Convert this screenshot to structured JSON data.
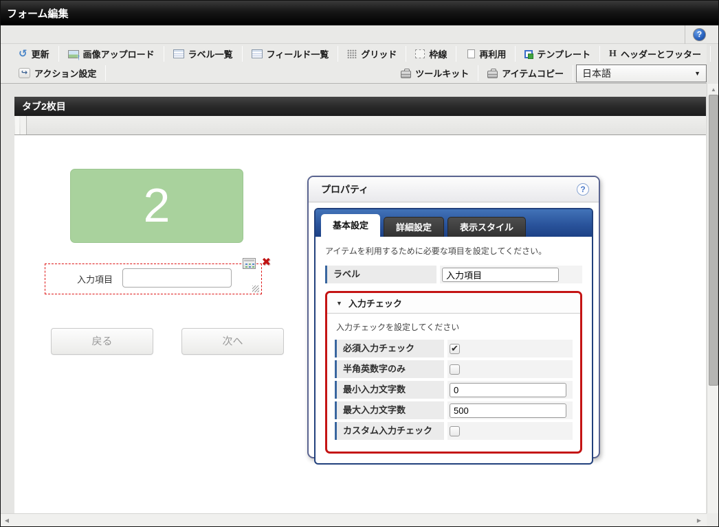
{
  "titlebar": {
    "title": "フォーム編集"
  },
  "header_strip": {
    "help_icon": "?"
  },
  "toolbar": {
    "row1": [
      {
        "label": "更新",
        "icon": "refresh-icon"
      },
      {
        "label": "画像アップロード",
        "icon": "image-upload-icon"
      },
      {
        "label": "ラベル一覧",
        "icon": "label-list-icon"
      },
      {
        "label": "フィールド一覧",
        "icon": "field-list-icon"
      },
      {
        "label": "グリッド",
        "icon": "grid-icon"
      },
      {
        "label": "枠線",
        "icon": "border-icon"
      },
      {
        "label": "再利用",
        "icon": "reuse-icon"
      },
      {
        "label": "テンプレート",
        "icon": "template-icon"
      },
      {
        "icon_text": "H",
        "label": "ヘッダーとフッター",
        "icon": "header-footer-icon"
      }
    ],
    "row2": [
      {
        "label": "アクション設定",
        "icon": "action-icon"
      },
      {
        "label": "ツールキット",
        "icon": "toolkit-icon"
      },
      {
        "label": "アイテムコピー",
        "icon": "item-copy-icon"
      }
    ],
    "language_select": {
      "value": "日本語",
      "arrow": "▼"
    }
  },
  "canvas": {
    "section_header": "タブ2枚目",
    "step_box": {
      "number": "2"
    },
    "selected_field": {
      "label": "入力項目",
      "value": "",
      "delete_glyph": "✖"
    },
    "buttons": {
      "back": "戻る",
      "next": "次へ"
    }
  },
  "properties": {
    "title": "プロパティ",
    "help_icon": "?",
    "tabs": [
      {
        "label": "基本設定"
      },
      {
        "label": "詳細設定"
      },
      {
        "label": "表示スタイル"
      }
    ],
    "instruction": "アイテムを利用するために必要な項目を設定してください。",
    "label_row": {
      "label": "ラベル",
      "value": "入力項目"
    },
    "validation_section": {
      "collapse_glyph": "▼",
      "title": "入力チェック",
      "instruction": "入力チェックを設定してください",
      "rows": [
        {
          "label": "必須入力チェック",
          "control": "checkbox",
          "check_glyph": "✔"
        },
        {
          "label": "半角英数字のみ",
          "control": "checkbox",
          "check_glyph": ""
        },
        {
          "label": "最小入力文字数",
          "control": "input",
          "value": "0"
        },
        {
          "label": "最大入力文字数",
          "control": "input",
          "value": "500"
        },
        {
          "label": "カスタム入力チェック",
          "control": "checkbox",
          "check_glyph": ""
        }
      ]
    }
  },
  "scrollbars": {
    "up": "▲",
    "down": "▼",
    "left": "◀",
    "right": "▶"
  },
  "colors": {
    "accent_blue": "#39669f",
    "tab_blue": "#2a549c",
    "highlight_red": "#c41414",
    "selection_red": "#dd1111",
    "step_green": "#a9d29d"
  }
}
